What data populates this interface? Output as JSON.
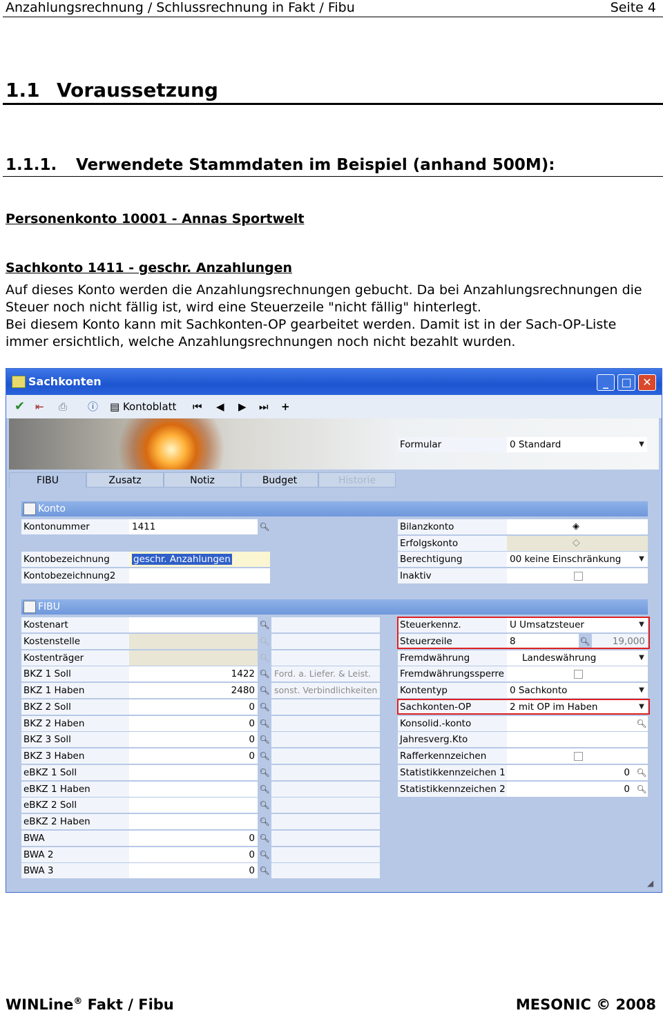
{
  "header": {
    "title": "Anzahlungsrechnung / Schlussrechnung in Fakt / Fibu",
    "page": "Seite 4"
  },
  "h1": {
    "num": "1.1",
    "text": "Voraussetzung"
  },
  "h2": {
    "num": "1.1.1.",
    "text": "Verwendete Stammdaten im Beispiel (anhand 500M):"
  },
  "subheading1": "Personenkonto 10001 - Annas Sportwelt",
  "subheading2": "Sachkonto 1411 - geschr. Anzahlungen",
  "paragraph1": "Auf dieses Konto werden die Anzahlungsrechnungen gebucht. Da bei Anzahlungsrechnungen die Steuer noch nicht fällig ist, wird eine Steuerzeile \"nicht fällig\" hinterlegt.",
  "paragraph2": "Bei diesem Konto kann mit Sachkonten-OP gearbeitet werden. Damit ist in der Sach-OP-Liste immer ersichtlich, welche Anzahlungsrechnungen noch nicht bezahlt wurden.",
  "window": {
    "title": "Sachkonten",
    "toolbar": {
      "kontoblatt": "Kontoblatt"
    },
    "formular": {
      "label": "Formular",
      "value": "0   Standard"
    },
    "tabs": [
      "FIBU",
      "Zusatz",
      "Notiz",
      "Budget",
      "Historie"
    ],
    "konto": {
      "section": "Konto",
      "kontonummer": {
        "label": "Kontonummer",
        "value": "1411"
      },
      "kontobezeichnung": {
        "label": "Kontobezeichnung",
        "value": "geschr. Anzahlungen"
      },
      "kontobezeichnung2": {
        "label": "Kontobezeichnung2",
        "value": ""
      },
      "bilanzkonto": {
        "label": "Bilanzkonto"
      },
      "erfolgskonto": {
        "label": "Erfolgskonto"
      },
      "berechtigung": {
        "label": "Berechtigung",
        "value": "00 keine Einschränkung"
      },
      "inaktiv": {
        "label": "Inaktiv"
      }
    },
    "fibu": {
      "section": "FIBU",
      "left": [
        {
          "label": "Kostenart",
          "value": "",
          "extra": ""
        },
        {
          "label": "Kostenstelle",
          "value": "",
          "extra": ""
        },
        {
          "label": "Kostenträger",
          "value": "",
          "extra": ""
        },
        {
          "label": "BKZ 1 Soll",
          "value": "1422",
          "extra": "Ford. a. Liefer. & Leist."
        },
        {
          "label": "BKZ 1 Haben",
          "value": "2480",
          "extra": "sonst. Verbindlichkeiten"
        },
        {
          "label": "BKZ 2 Soll",
          "value": "0",
          "extra": ""
        },
        {
          "label": "BKZ 2 Haben",
          "value": "0",
          "extra": ""
        },
        {
          "label": "BKZ 3 Soll",
          "value": "0",
          "extra": ""
        },
        {
          "label": "BKZ 3 Haben",
          "value": "0",
          "extra": ""
        },
        {
          "label": "eBKZ 1 Soll",
          "value": "",
          "extra": ""
        },
        {
          "label": "eBKZ 1 Haben",
          "value": "",
          "extra": ""
        },
        {
          "label": "eBKZ 2 Soll",
          "value": "",
          "extra": ""
        },
        {
          "label": "eBKZ 2 Haben",
          "value": "",
          "extra": ""
        },
        {
          "label": "BWA",
          "value": "0",
          "extra": ""
        },
        {
          "label": "BWA 2",
          "value": "0",
          "extra": ""
        },
        {
          "label": "BWA 3",
          "value": "0",
          "extra": ""
        }
      ],
      "right": [
        {
          "label": "Steuerkennz.",
          "value": "U Umsatzsteuer",
          "extra": ""
        },
        {
          "label": "Steuerzeile",
          "value": "8",
          "extra": "19,000"
        },
        {
          "label": "Fremdwährung",
          "value": "Landeswährung",
          "extra": ""
        },
        {
          "label": "Fremdwährungssperre",
          "value": "",
          "extra": ""
        },
        {
          "label": "Kontentyp",
          "value": "0 Sachkonto",
          "extra": ""
        },
        {
          "label": "Sachkonten-OP",
          "value": "2 mit OP im Haben",
          "extra": ""
        },
        {
          "label": "Konsolid.-konto",
          "value": "",
          "extra": ""
        },
        {
          "label": "Jahresverg.Kto",
          "value": "",
          "extra": ""
        },
        {
          "label": "Rafferkennzeichen",
          "value": "",
          "extra": ""
        },
        {
          "label": "Statistikkennzeichen 1",
          "value": "0",
          "extra": ""
        },
        {
          "label": "Statistikkennzeichen 2",
          "value": "0",
          "extra": ""
        }
      ]
    }
  },
  "footer": {
    "left_brand": "WINLine",
    "left_reg": "®",
    "left_rest": " Fakt / Fibu",
    "right": "MESONIC © 2008"
  }
}
